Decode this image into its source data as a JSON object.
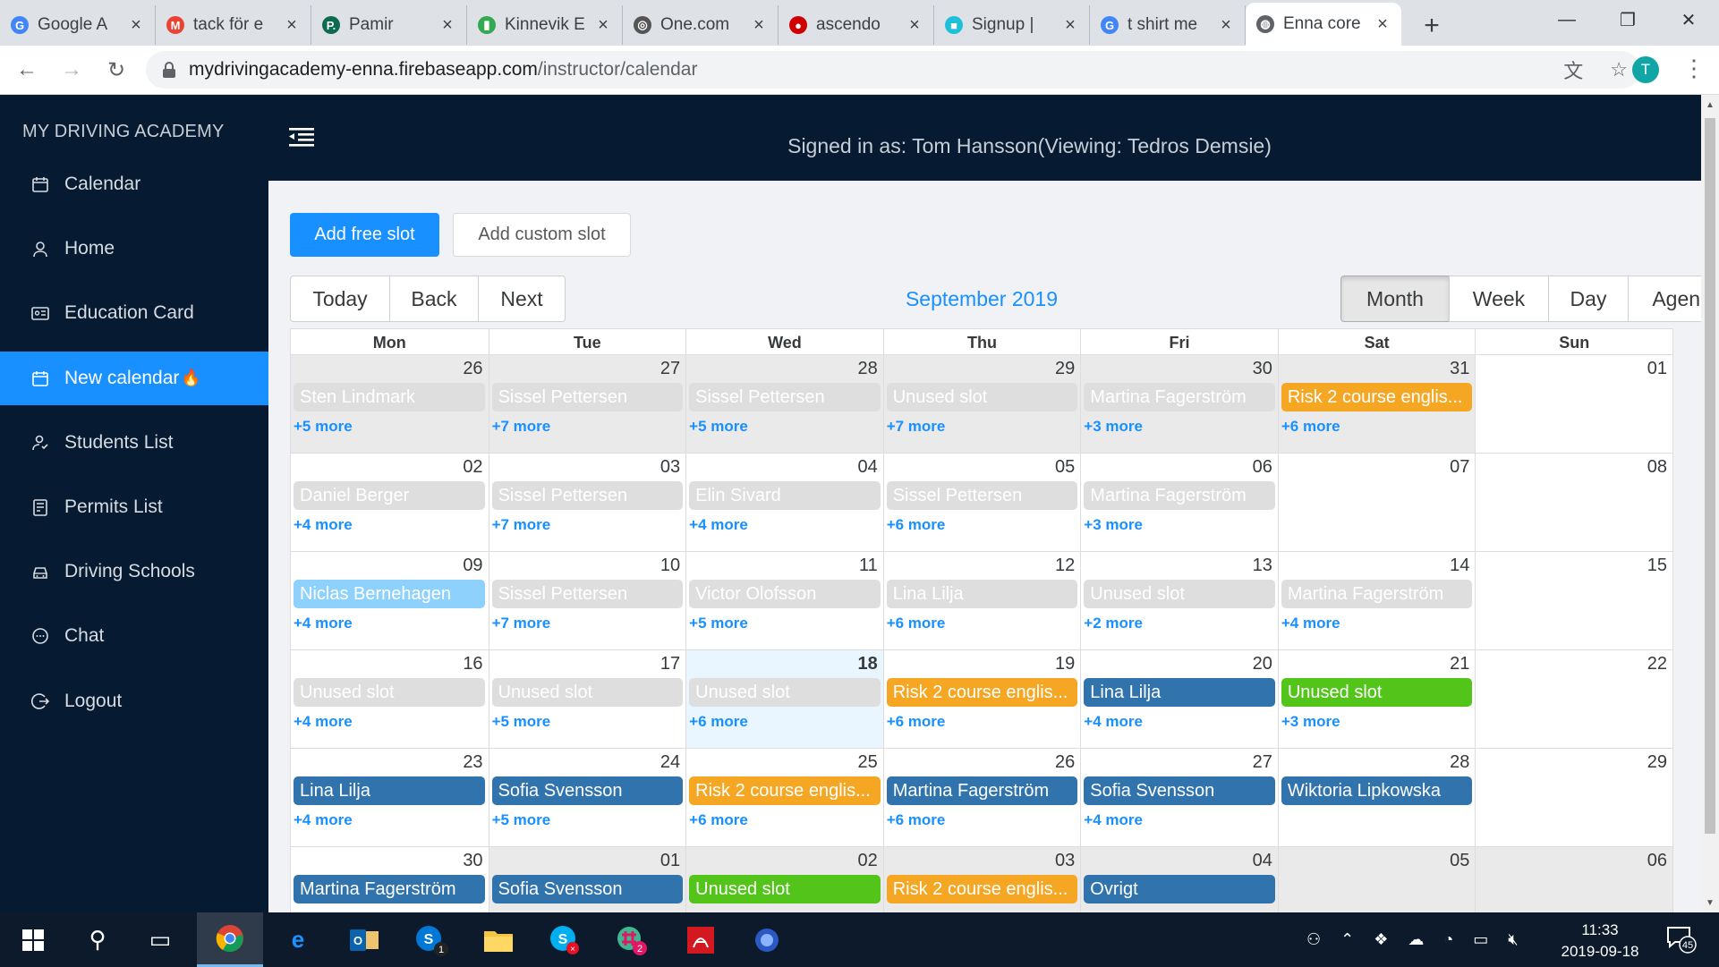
{
  "browser": {
    "tabs": [
      {
        "title": "Google A",
        "fav": "G",
        "color": "#4285f4",
        "icon": "google-icon"
      },
      {
        "title": "tack för e",
        "fav": "M",
        "color": "#ea4335",
        "icon": "gmail-icon"
      },
      {
        "title": "Pamir",
        "fav": "P.",
        "color": "#0f6b50",
        "icon": "pamir-icon"
      },
      {
        "title": "Kinnevik E",
        "fav": "▮",
        "color": "#34a853",
        "icon": "chart-icon"
      },
      {
        "title": "One.com",
        "fav": "◎",
        "color": "#555555",
        "icon": "onecom-icon"
      },
      {
        "title": "ascendo",
        "fav": "●",
        "color": "#d00000",
        "icon": "ascendo-icon"
      },
      {
        "title": "Signup |",
        "fav": "■",
        "color": "#1ec0d8",
        "icon": "signup-icon"
      },
      {
        "title": "t shirt me",
        "fav": "G",
        "color": "#4285f4",
        "icon": "google-icon"
      },
      {
        "title": "Enna core",
        "fav": "◍",
        "color": "#5f6368",
        "icon": "globe-icon",
        "active": true
      }
    ],
    "url_host": "mydrivingacademy-enna.firebaseapp.com",
    "url_path": "/instructor/calendar",
    "profile_initial": "T"
  },
  "sidebar": {
    "brand": "MY DRIVING ACADEMY",
    "items": [
      {
        "label": "Calendar",
        "icon": "calendar-icon"
      },
      {
        "label": "Home",
        "icon": "user-icon"
      },
      {
        "label": "Education Card",
        "icon": "id-card-icon"
      },
      {
        "label": "New calendar",
        "icon": "calendar-icon",
        "active": true,
        "suffix": "🔥"
      },
      {
        "label": "Students List",
        "icon": "students-icon"
      },
      {
        "label": "Permits List",
        "icon": "permits-icon"
      },
      {
        "label": "Driving Schools",
        "icon": "car-icon"
      },
      {
        "label": "Chat",
        "icon": "chat-icon"
      },
      {
        "label": "Logout",
        "icon": "logout-icon"
      }
    ]
  },
  "header": {
    "signed_in": "Signed in as: Tom Hansson(Viewing: Tedros Demsie)"
  },
  "actions": {
    "add_free": "Add free slot",
    "add_custom": "Add custom slot"
  },
  "toolbar": {
    "nav": [
      "Today",
      "Back",
      "Next"
    ],
    "label": "September 2019",
    "views": [
      "Month",
      "Week",
      "Day",
      "Agenda"
    ],
    "active_view": "Month"
  },
  "calendar": {
    "weekdays": [
      "Mon",
      "Tue",
      "Wed",
      "Thu",
      "Fri",
      "Sat",
      "Sun"
    ],
    "weeks": [
      [
        {
          "date": "26",
          "off": true,
          "event": "Sten Lindmark",
          "color": "grey",
          "more": "+5 more"
        },
        {
          "date": "27",
          "off": true,
          "event": "Sissel Pettersen",
          "color": "grey",
          "more": "+7 more"
        },
        {
          "date": "28",
          "off": true,
          "event": "Sissel Pettersen",
          "color": "grey",
          "more": "+5 more"
        },
        {
          "date": "29",
          "off": true,
          "event": "Unused slot",
          "color": "grey",
          "more": "+7 more"
        },
        {
          "date": "30",
          "off": true,
          "event": "Martina Fagerström",
          "color": "grey",
          "more": "+3 more"
        },
        {
          "date": "31",
          "off": true,
          "event": "Risk 2 course englis...",
          "color": "orange",
          "more": "+6 more"
        },
        {
          "date": "01"
        }
      ],
      [
        {
          "date": "02",
          "event": "Daniel Berger",
          "color": "grey",
          "more": "+4 more"
        },
        {
          "date": "03",
          "event": "Sissel Pettersen",
          "color": "grey",
          "more": "+7 more"
        },
        {
          "date": "04",
          "event": "Elin Sivard",
          "color": "grey",
          "more": "+4 more"
        },
        {
          "date": "05",
          "event": "Sissel Pettersen",
          "color": "grey",
          "more": "+6 more"
        },
        {
          "date": "06",
          "event": "Martina Fagerström",
          "color": "grey",
          "more": "+3 more"
        },
        {
          "date": "07"
        },
        {
          "date": "08"
        }
      ],
      [
        {
          "date": "09",
          "event": "Niclas Bernehagen",
          "color": "light",
          "more": "+4 more"
        },
        {
          "date": "10",
          "event": "Sissel Pettersen",
          "color": "grey",
          "more": "+7 more"
        },
        {
          "date": "11",
          "event": "Victor Olofsson",
          "color": "grey",
          "more": "+5 more"
        },
        {
          "date": "12",
          "event": "Lina Lilja",
          "color": "grey",
          "more": "+6 more"
        },
        {
          "date": "13",
          "event": "Unused slot",
          "color": "grey",
          "more": "+2 more"
        },
        {
          "date": "14",
          "event": "Martina Fagerström",
          "color": "grey",
          "more": "+4 more"
        },
        {
          "date": "15"
        }
      ],
      [
        {
          "date": "16",
          "event": "Unused slot",
          "color": "grey",
          "more": "+4 more"
        },
        {
          "date": "17",
          "event": "Unused slot",
          "color": "grey",
          "more": "+5 more"
        },
        {
          "date": "18",
          "today": true,
          "event": "Unused slot",
          "color": "grey",
          "more": "+6 more"
        },
        {
          "date": "19",
          "event": "Risk 2 course englis...",
          "color": "orange",
          "more": "+6 more"
        },
        {
          "date": "20",
          "event": "Lina Lilja",
          "color": "blue",
          "more": "+4 more"
        },
        {
          "date": "21",
          "event": "Unused slot",
          "color": "green",
          "more": "+3 more"
        },
        {
          "date": "22"
        }
      ],
      [
        {
          "date": "23",
          "event": "Lina Lilja",
          "color": "blue",
          "more": "+4 more"
        },
        {
          "date": "24",
          "event": "Sofia Svensson",
          "color": "blue",
          "more": "+5 more"
        },
        {
          "date": "25",
          "event": "Risk 2 course englis...",
          "color": "orange",
          "more": "+6 more"
        },
        {
          "date": "26",
          "event": "Martina Fagerström",
          "color": "blue",
          "more": "+6 more"
        },
        {
          "date": "27",
          "event": "Sofia Svensson",
          "color": "blue",
          "more": "+4 more"
        },
        {
          "date": "28",
          "event": "Wiktoria Lipkowska",
          "color": "blue"
        },
        {
          "date": "29"
        }
      ],
      [
        {
          "date": "30",
          "event": "Martina Fagerström",
          "color": "blue"
        },
        {
          "date": "01",
          "off": true,
          "event": "Sofia Svensson",
          "color": "blue"
        },
        {
          "date": "02",
          "off": true,
          "event": "Unused slot",
          "color": "green"
        },
        {
          "date": "03",
          "off": true,
          "event": "Risk 2 course englis...",
          "color": "orange"
        },
        {
          "date": "04",
          "off": true,
          "event": "Ovrigt",
          "color": "blue"
        },
        {
          "date": "05",
          "off": true
        },
        {
          "date": "06",
          "off": true
        }
      ]
    ]
  },
  "taskbar": {
    "time": "11:33",
    "date": "2019-09-18",
    "notifications": "45",
    "skype_badge": "1",
    "slack_badge": "2"
  }
}
